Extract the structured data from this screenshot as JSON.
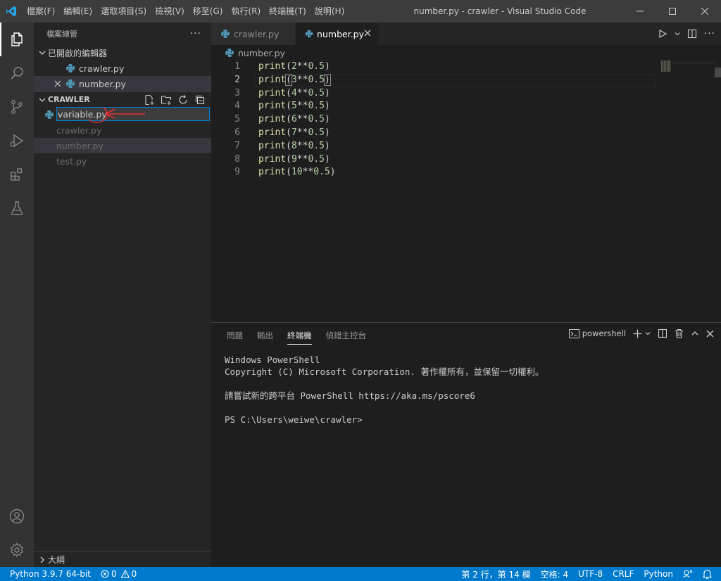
{
  "window": {
    "title": "number.py - crawler - Visual Studio Code",
    "menu": [
      "檔案(F)",
      "編輯(E)",
      "選取項目(S)",
      "檢視(V)",
      "移至(G)",
      "執行(R)",
      "終端機(T)",
      "說明(H)"
    ]
  },
  "sidebar": {
    "header": "檔案總管",
    "open_editors": {
      "title": "已開啟的編輯器",
      "items": [
        {
          "name": "crawler.py"
        },
        {
          "name": "number.py"
        }
      ]
    },
    "folder": {
      "title": "CRAWLER",
      "rename_value": "variable.py",
      "files": [
        "crawler.py",
        "number.py",
        "test.py"
      ]
    },
    "outline_title": "大綱"
  },
  "editor": {
    "tabs": [
      {
        "label": "crawler.py"
      },
      {
        "label": "number.py"
      }
    ],
    "breadcrumb": "number.py",
    "lines": [
      {
        "n": "1",
        "fn": "print",
        "arg": "2",
        "op": "**",
        "exp": "0.5"
      },
      {
        "n": "2",
        "fn": "print",
        "arg": "3",
        "op": "**",
        "exp": "0.5"
      },
      {
        "n": "3",
        "fn": "print",
        "arg": "4",
        "op": "**",
        "exp": "0.5"
      },
      {
        "n": "4",
        "fn": "print",
        "arg": "5",
        "op": "**",
        "exp": "0.5"
      },
      {
        "n": "5",
        "fn": "print",
        "arg": "6",
        "op": "**",
        "exp": "0.5"
      },
      {
        "n": "6",
        "fn": "print",
        "arg": "7",
        "op": "**",
        "exp": "0.5"
      },
      {
        "n": "7",
        "fn": "print",
        "arg": "8",
        "op": "**",
        "exp": "0.5"
      },
      {
        "n": "8",
        "fn": "print",
        "arg": "9",
        "op": "**",
        "exp": "0.5"
      },
      {
        "n": "9",
        "fn": "print",
        "arg": "10",
        "op": "**",
        "exp": "0.5"
      }
    ]
  },
  "panel": {
    "tabs": [
      "問題",
      "輸出",
      "終端機",
      "偵錯主控台"
    ],
    "shell_label": "powershell",
    "terminal_lines": [
      "Windows PowerShell",
      "Copyright (C) Microsoft Corporation. 著作權所有，並保留一切權利。",
      "",
      "請嘗試新的跨平台 PowerShell https://aka.ms/pscore6",
      "",
      "PS C:\\Users\\weiwe\\crawler>"
    ]
  },
  "statusbar": {
    "interpreter": "Python 3.9.7 64-bit",
    "errors": "0",
    "warnings": "0",
    "position": "第 2 行，第 14 欄",
    "indent": "空格: 4",
    "encoding": "UTF-8",
    "eol": "CRLF",
    "language": "Python"
  },
  "colors": {
    "accent": "#007acc",
    "annotation": "#e03030"
  }
}
